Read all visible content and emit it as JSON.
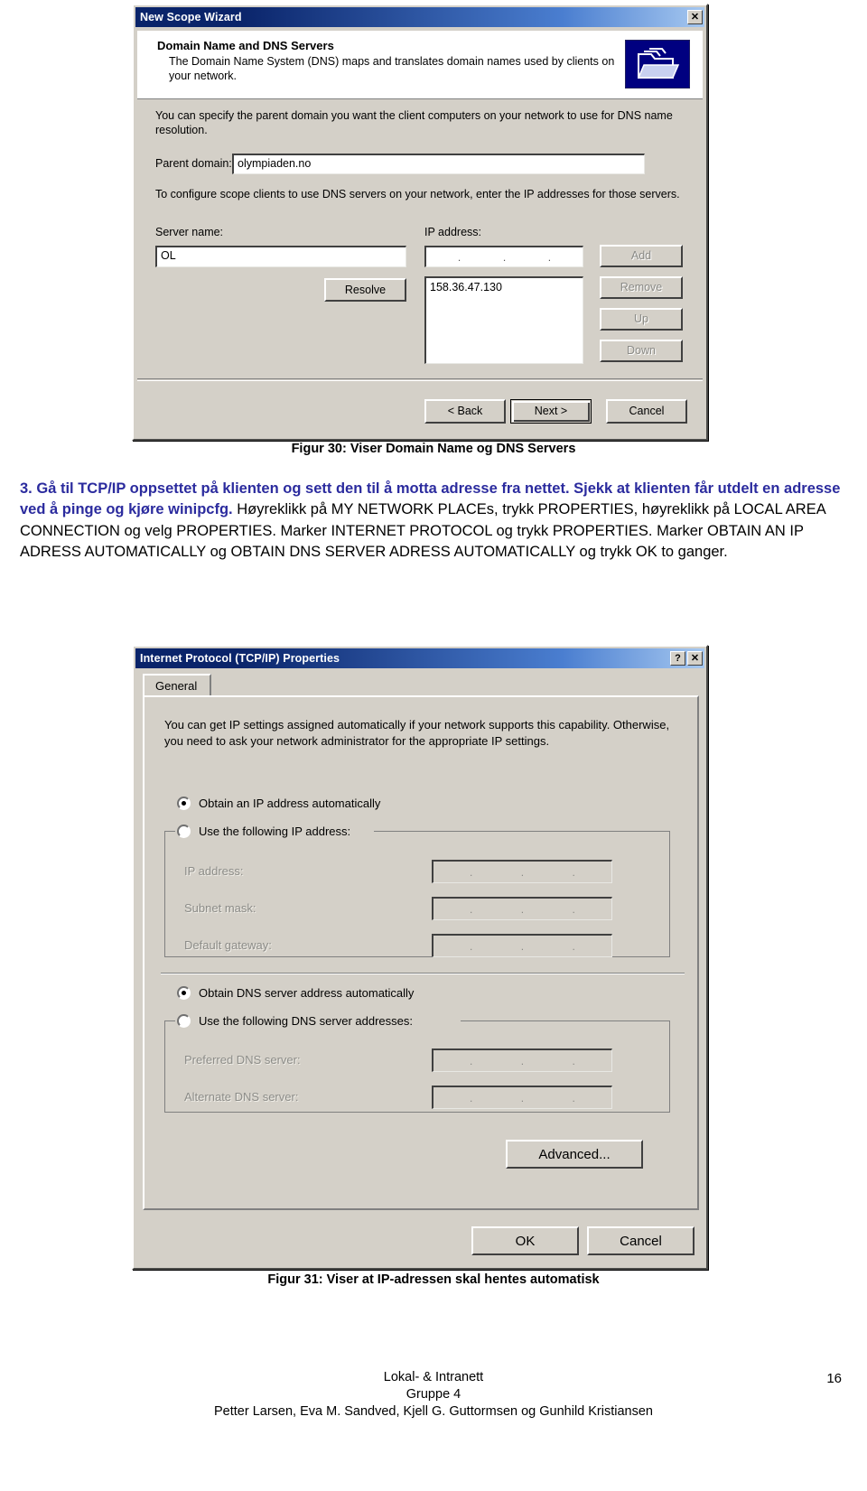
{
  "wizard": {
    "title": "New Scope Wizard",
    "close_label": "✕",
    "heading": "Domain Name and DNS Servers",
    "subheading": "The Domain Name System (DNS) maps and translates domain names used by clients on your network.",
    "icon": "dns-folder-icon",
    "intro": "You can specify the parent domain you want the client computers on your network to use for DNS name resolution.",
    "parent_domain_label": "Parent domain:",
    "parent_domain_value": "olympiaden.no",
    "dns_intro": "To configure scope clients to use DNS servers on your network, enter the IP addresses for those servers.",
    "server_name_label": "Server name:",
    "server_name_value": "OL",
    "ip_address_label": "IP address:",
    "ip_octet_sep": ".",
    "resolve_label": "Resolve",
    "add_label": "Add",
    "remove_label": "Remove",
    "up_label": "Up",
    "down_label": "Down",
    "dns_list": [
      "158.36.47.130"
    ],
    "back_label": "< Back",
    "next_label": "Next >",
    "cancel_label": "Cancel"
  },
  "figure30_caption": "Figur 30: Viser Domain Name og DNS Servers",
  "body": {
    "step_number": "3.",
    "bold_line_1": "Gå til TCP/IP oppsettet på klienten og sett den til å motta adresse fra",
    "bold_line_2": "nettet. Sjekk at klienten får utdelt en adresse ved å pinge og kjøre winipcfg.",
    "plain_text": "Høyreklikk på MY NETWORK PLACEs, trykk PROPERTIES, høyreklikk på LOCAL AREA CONNECTION og velg PROPERTIES. Marker INTERNET PROTOCOL og trykk PROPERTIES. Marker OBTAIN AN IP ADRESS AUTOMATICALLY og OBTAIN DNS SERVER ADRESS AUTOMATICALLY og trykk OK to ganger."
  },
  "tcpip": {
    "title": "Internet Protocol (TCP/IP) Properties",
    "help_label": "?",
    "close_label": "✕",
    "tab_general": "General",
    "description": "You can get IP settings assigned automatically if your network supports this capability. Otherwise, you need to ask your network administrator for the appropriate IP settings.",
    "radio_ip_auto": "Obtain an IP address automatically",
    "radio_ip_manual": "Use the following IP address:",
    "label_ip_address": "IP address:",
    "label_subnet_mask": "Subnet mask:",
    "label_default_gateway": "Default gateway:",
    "radio_dns_auto": "Obtain DNS server address automatically",
    "radio_dns_manual": "Use the following DNS server addresses:",
    "label_preferred_dns": "Preferred DNS server:",
    "label_alternate_dns": "Alternate DNS server:",
    "advanced_label": "Advanced...",
    "ok_label": "OK",
    "cancel_label": "Cancel",
    "ip_octet_sep": ".",
    "selected_ip_option": "Obtain an IP address automatically",
    "selected_dns_option": "Obtain DNS server address automatically"
  },
  "figure31_caption": "Figur 31: Viser at IP-adressen skal hentes automatisk",
  "footer": {
    "line1": "Lokal- & Intranett",
    "line2": "Gruppe 4",
    "line3": "Petter Larsen, Eva M. Sandved, Kjell G. Guttormsen og Gunhild Kristiansen",
    "page_number": "16"
  },
  "colors": {
    "titlebar_dark": "#0a246a",
    "dialog_face": "#d4d0c8",
    "heading_blue": "#2b2b9e"
  }
}
